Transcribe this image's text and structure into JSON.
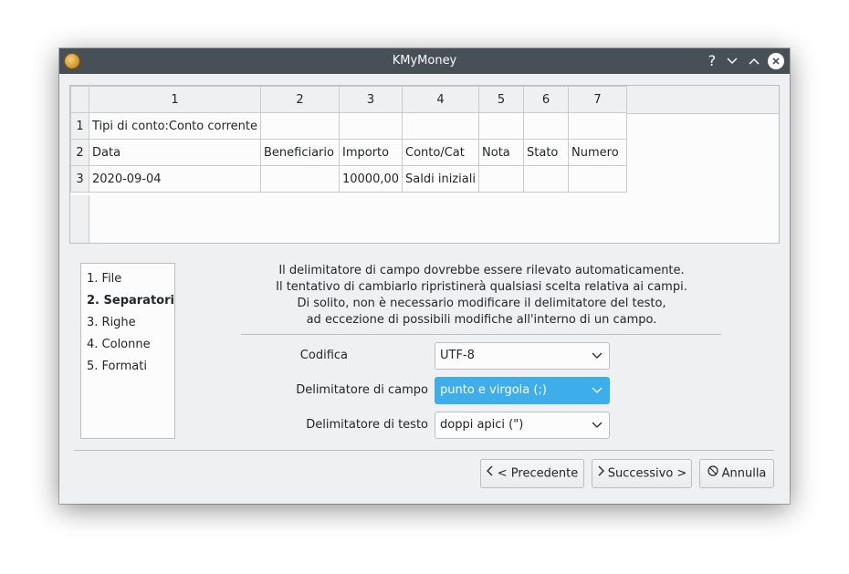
{
  "window": {
    "title": "KMyMoney"
  },
  "titlebar": {
    "help": "?",
    "minimize": "⌄",
    "maximize": "⌃",
    "close": "✕"
  },
  "grid": {
    "columns": [
      "1",
      "2",
      "3",
      "4",
      "5",
      "6",
      "7"
    ],
    "row_headers": [
      "1",
      "2",
      "3"
    ],
    "rows": [
      [
        "Tipi di conto:Conto corrente",
        "",
        "",
        "",
        "",
        "",
        ""
      ],
      [
        "Data",
        "Beneficiario",
        "Importo",
        "Conto/Cat",
        "Nota",
        "Stato",
        "Numero"
      ],
      [
        "2020-09-04",
        "",
        "10000,00",
        "Saldi iniziali",
        "",
        "",
        ""
      ]
    ]
  },
  "steps": [
    "1. File",
    "2. Separatori",
    "3. Righe",
    "4. Colonne",
    "5. Formati"
  ],
  "description": [
    "Il delimitatore di campo dovrebbe essere rilevato automaticamente.",
    "Il tentativo di cambiarlo ripristinerà qualsiasi scelta relativa ai campi.",
    "Di solito, non è necessario modificare il delimitatore del testo,",
    "ad eccezione di possibili modifiche all'interno di un campo."
  ],
  "form": {
    "encoding": {
      "label": "Codifica",
      "value": "UTF-8"
    },
    "field_delimiter": {
      "label": "Delimitatore di campo",
      "value": "punto e virgola (;)"
    },
    "text_delimiter": {
      "label": "Delimitatore di testo",
      "value": "doppi apici (\")"
    }
  },
  "buttons": {
    "previous": "< Precedente",
    "next": "Successivo >",
    "cancel": "Annulla"
  }
}
